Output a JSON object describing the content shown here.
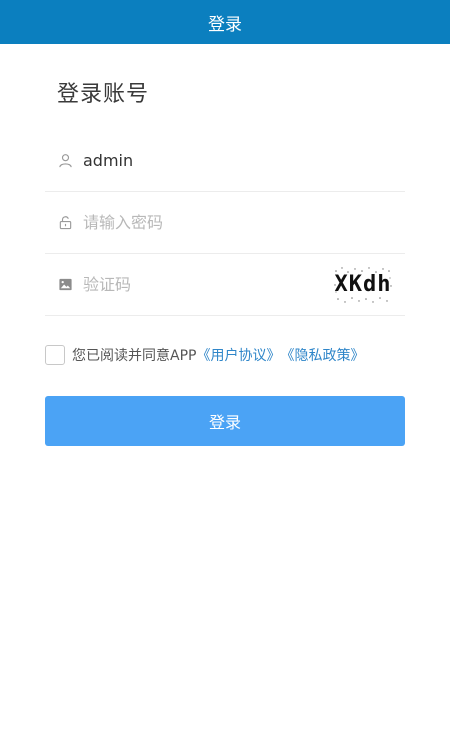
{
  "header": {
    "title": "登录"
  },
  "page_title": "登录账号",
  "form": {
    "username": {
      "value": "admin",
      "placeholder": "",
      "icon": "user-icon"
    },
    "password": {
      "value": "",
      "placeholder": "请输入密码",
      "icon": "lock-icon"
    },
    "captcha": {
      "value": "",
      "placeholder": "验证码",
      "icon": "image-icon",
      "image_text": "XKdh"
    }
  },
  "agreement": {
    "prefix": "您已阅读并同意APP",
    "user_agreement": "《用户协议》",
    "privacy_policy": "《隐私政策》"
  },
  "login_button": "登录",
  "colors": {
    "header_bg": "#0b7fbf",
    "button_bg": "#4ba3f5",
    "link": "#2f86c9"
  }
}
